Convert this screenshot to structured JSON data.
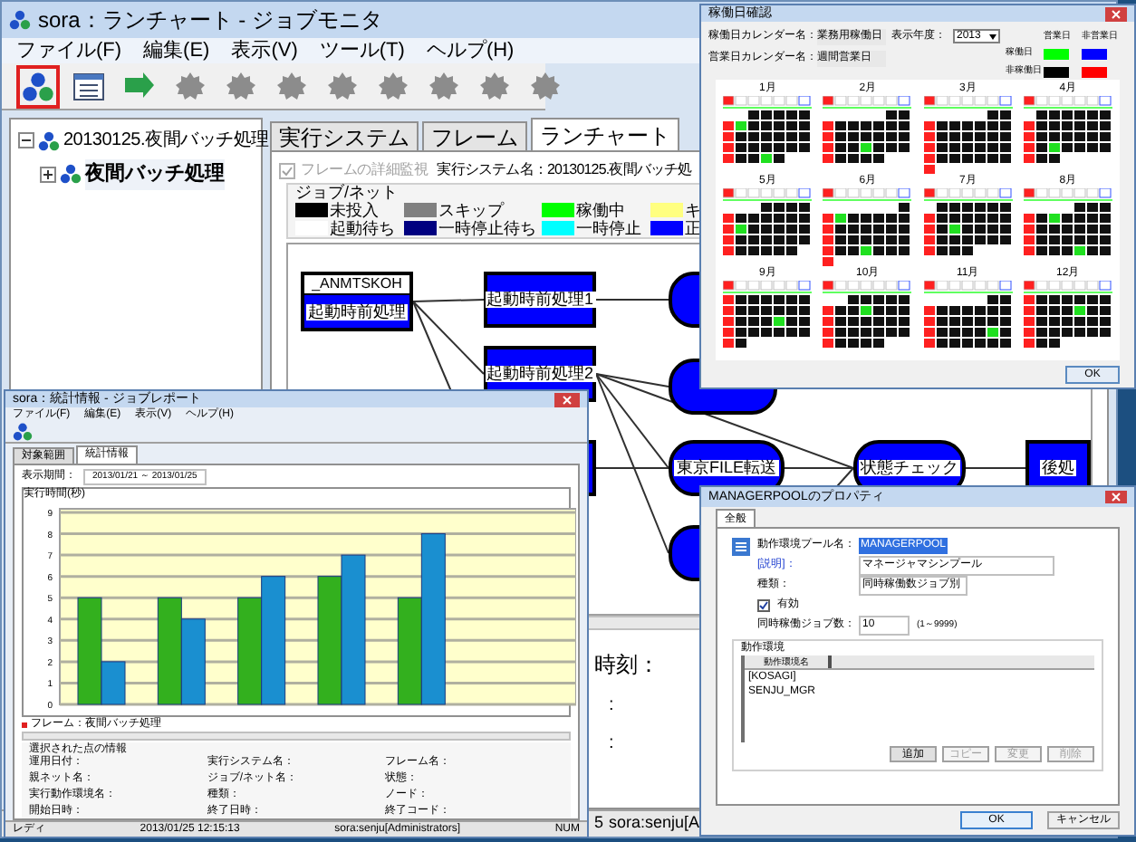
{
  "main_window": {
    "title": "sora：ランチャート - ジョブモニタ",
    "menu": [
      "ファイル(F)",
      "編集(E)",
      "表示(V)",
      "ツール(T)",
      "ヘルプ(H)"
    ],
    "toolbar": [
      {
        "selected": true,
        "disabled": false
      },
      {
        "selected": false,
        "disabled": false
      },
      {
        "selected": false,
        "disabled": false
      },
      {
        "selected": false,
        "disabled": true
      },
      {
        "selected": false,
        "disabled": true
      },
      {
        "selected": false,
        "disabled": true
      },
      {
        "selected": false,
        "disabled": true
      },
      {
        "selected": false,
        "disabled": true
      },
      {
        "selected": false,
        "disabled": true
      },
      {
        "selected": false,
        "disabled": true
      },
      {
        "selected": false,
        "disabled": true
      }
    ],
    "tree": [
      {
        "label": "20130125.夜間バッチ処理",
        "expanded": true,
        "selected": false,
        "children": [
          {
            "label": "夜間バッチ処理",
            "expanded": false,
            "selected": true
          }
        ]
      }
    ],
    "tabs": [
      {
        "label": "実行システム",
        "selected": false
      },
      {
        "label": "フレーム",
        "selected": false
      },
      {
        "label": "ランチャート",
        "selected": true
      }
    ],
    "detail_monitor": {
      "label": "フレームの詳細監視",
      "checked": true,
      "disabled": true
    },
    "system_name": "実行システム名：20130125.夜間バッチ処",
    "legend": {
      "title": "ジョブ/ネット",
      "items": [
        {
          "label": "未投入",
          "color": "#000000"
        },
        {
          "label": "スキップ",
          "color": "#808080"
        },
        {
          "label": "稼働中",
          "color": "#00ff00"
        },
        {
          "label": "キ",
          "color": "#ffff80"
        },
        {
          "label": "起動待ち",
          "color": "#ffffff"
        },
        {
          "label": "一時停止待ち",
          "color": "#000080"
        },
        {
          "label": "一時停止",
          "color": "#00ffff"
        },
        {
          "label": "正",
          "color": "#0000ff"
        }
      ]
    },
    "nodes": [
      {
        "kind": "net",
        "header": "_ANMTSKOH",
        "label": "起動時前処理"
      },
      {
        "kind": "job",
        "label": "起動時前処理1"
      },
      {
        "kind": "job",
        "label": "起動時前処理2"
      },
      {
        "kind": "round"
      },
      {
        "kind": "round"
      },
      {
        "kind": "round",
        "label": "東京FILE転送"
      },
      {
        "kind": "round",
        "label": "状態チェック"
      },
      {
        "kind": "job",
        "label": "後処"
      },
      {
        "kind": "round"
      },
      {
        "kind": "job"
      }
    ],
    "fields": [
      {
        "label": "時刻："
      },
      {
        "label": ":"
      },
      {
        "label": ":"
      }
    ],
    "status_bar": [
      "5",
      "sora:senju[A"
    ]
  },
  "calendar_window": {
    "title": "稼働日確認",
    "rows": [
      {
        "label": "稼働日カレンダー名：",
        "value": "業務用稼働日"
      },
      {
        "label": "営業日カレンダー名：",
        "value": "週間営業日"
      }
    ],
    "year": {
      "label": "表示年度：",
      "value": "2013"
    },
    "legend": {
      "columns": [
        "営業日",
        "非営業日"
      ],
      "rows": [
        {
          "label": "稼働日",
          "swatches": [
            {
              "color": "#00ff00"
            },
            {
              "color": "#0000ff"
            }
          ]
        },
        {
          "label": "非稼働日",
          "swatches": [
            {
              "color": "#000000"
            },
            {
              "color": "#ff0000"
            }
          ]
        }
      ]
    },
    "months": [
      "1月",
      "2月",
      "3月",
      "4月",
      "5月",
      "6月",
      "7月",
      "8月",
      "9月",
      "10月",
      "11月",
      "12月"
    ],
    "ok": "OK"
  },
  "report_window": {
    "title": "sora：統計情報 - ジョブレポート",
    "menu": [
      "ファイル(F)",
      "編集(E)",
      "表示(V)",
      "ヘルプ(H)"
    ],
    "tabs": [
      {
        "label": "対象範囲",
        "selected": false
      },
      {
        "label": "統計情報",
        "selected": true
      }
    ],
    "period": {
      "label": "表示期間：",
      "from": "2013/01/21",
      "separator": "～",
      "to": "2013/01/25"
    },
    "chart_title": "実行時間(秒)",
    "chart_data": {
      "type": "bar",
      "grid": true,
      "ylim": [
        0,
        9
      ],
      "yticks": [
        0,
        1,
        2,
        3,
        4,
        5,
        6,
        7,
        8,
        9
      ],
      "series": [
        {
          "color": "#33b01e",
          "values": [
            5,
            5,
            5,
            6,
            5,
            null
          ]
        },
        {
          "color": "#1a8fd0",
          "values": [
            2,
            4,
            6,
            7,
            8,
            null
          ]
        }
      ]
    },
    "legend": "フレーム：夜間バッチ処理",
    "info": {
      "title": "選択された点の情報",
      "fields": [
        "運用日付：",
        "実行システム名：",
        "フレーム名：",
        "親ネット名：",
        "ジョブ/ネット名：",
        "状態：",
        "実行動作環境名：",
        "種類：",
        "ノード：",
        "開始日時：",
        "終了日時：",
        "終了コード："
      ]
    },
    "status_bar": [
      "レディ",
      "2013/01/25 12:15:13",
      "sora:senju[Administrators]",
      "NUM"
    ]
  },
  "property_dialog": {
    "title": "MANAGERPOOLのプロパティ",
    "tabs": [
      {
        "label": "全般",
        "selected": true
      }
    ],
    "name": {
      "label": "動作環境プール名：",
      "value": "MANAGERPOOL"
    },
    "description": {
      "label": "[説明]：",
      "value": "マネージャマシンプール"
    },
    "type": {
      "label": "種類：",
      "value": "同時稼働数ジョブ別"
    },
    "enabled": {
      "label": "有効",
      "checked": true
    },
    "max_jobs": {
      "label": "同時稼働ジョブ数：",
      "value": "10",
      "range": "(1～9999)"
    },
    "group": {
      "title": "動作環境",
      "column": "動作環境名",
      "rows": [
        "[KOSAGI]",
        "SENJU_MGR"
      ]
    },
    "list_buttons": [
      {
        "label": "追加",
        "disabled": false
      },
      {
        "label": "コピー",
        "disabled": true
      },
      {
        "label": "変更",
        "disabled": true
      },
      {
        "label": "削除",
        "disabled": true
      }
    ],
    "buttons": [
      "OK",
      "キャンセル"
    ]
  }
}
